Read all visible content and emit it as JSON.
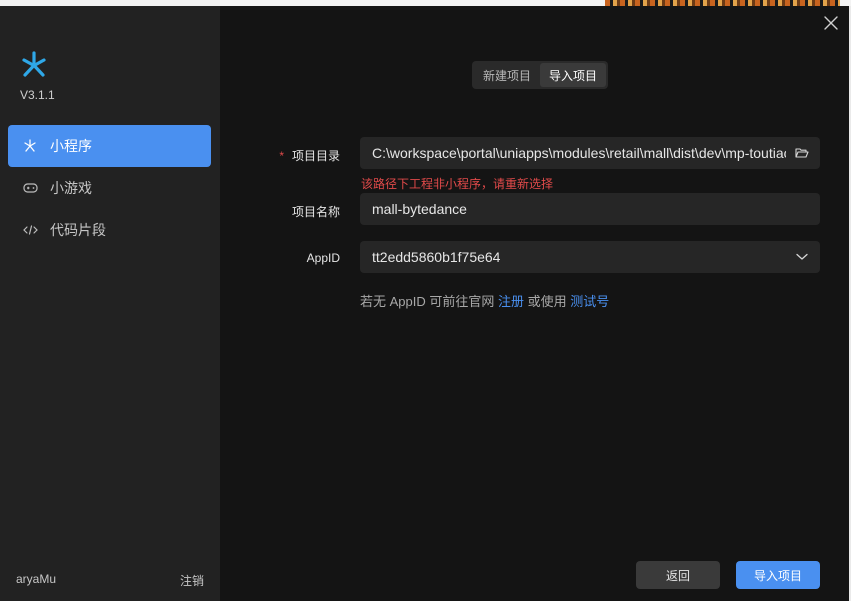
{
  "app": {
    "version": "V3.1.1",
    "brand_color": "#4a90f0",
    "logo_color": "#2fa8e8"
  },
  "sidebar": {
    "items": [
      {
        "label": "小程序",
        "icon": "asterisk-icon",
        "active": true
      },
      {
        "label": "小游戏",
        "icon": "gamepad-icon",
        "active": false
      },
      {
        "label": "代码片段",
        "icon": "code-icon",
        "active": false
      }
    ],
    "user": "aryaMu",
    "logout_label": "注销"
  },
  "tabs": [
    {
      "label": "新建项目",
      "active": false
    },
    {
      "label": "导入项目",
      "active": true
    }
  ],
  "form": {
    "project_dir": {
      "label": "项目目录",
      "required_mark": "*",
      "value": "C:\\workspace\\portal\\uniapps\\modules\\retail\\mall\\dist\\dev\\mp-toutiao",
      "icon": "folder-open-icon",
      "error": "该路径下工程非小程序，请重新选择"
    },
    "project_name": {
      "label": "项目名称",
      "value": "mall-bytedance"
    },
    "appid": {
      "label": "AppID",
      "value": "tt2edd5860b1f75e64",
      "icon": "chevron-down-icon"
    },
    "hint": {
      "prefix": "若无 AppID 可前往官网",
      "register_link": "注册",
      "middle": "或使用",
      "test_link": "测试号"
    }
  },
  "buttons": {
    "back": "返回",
    "import": "导入项目"
  }
}
